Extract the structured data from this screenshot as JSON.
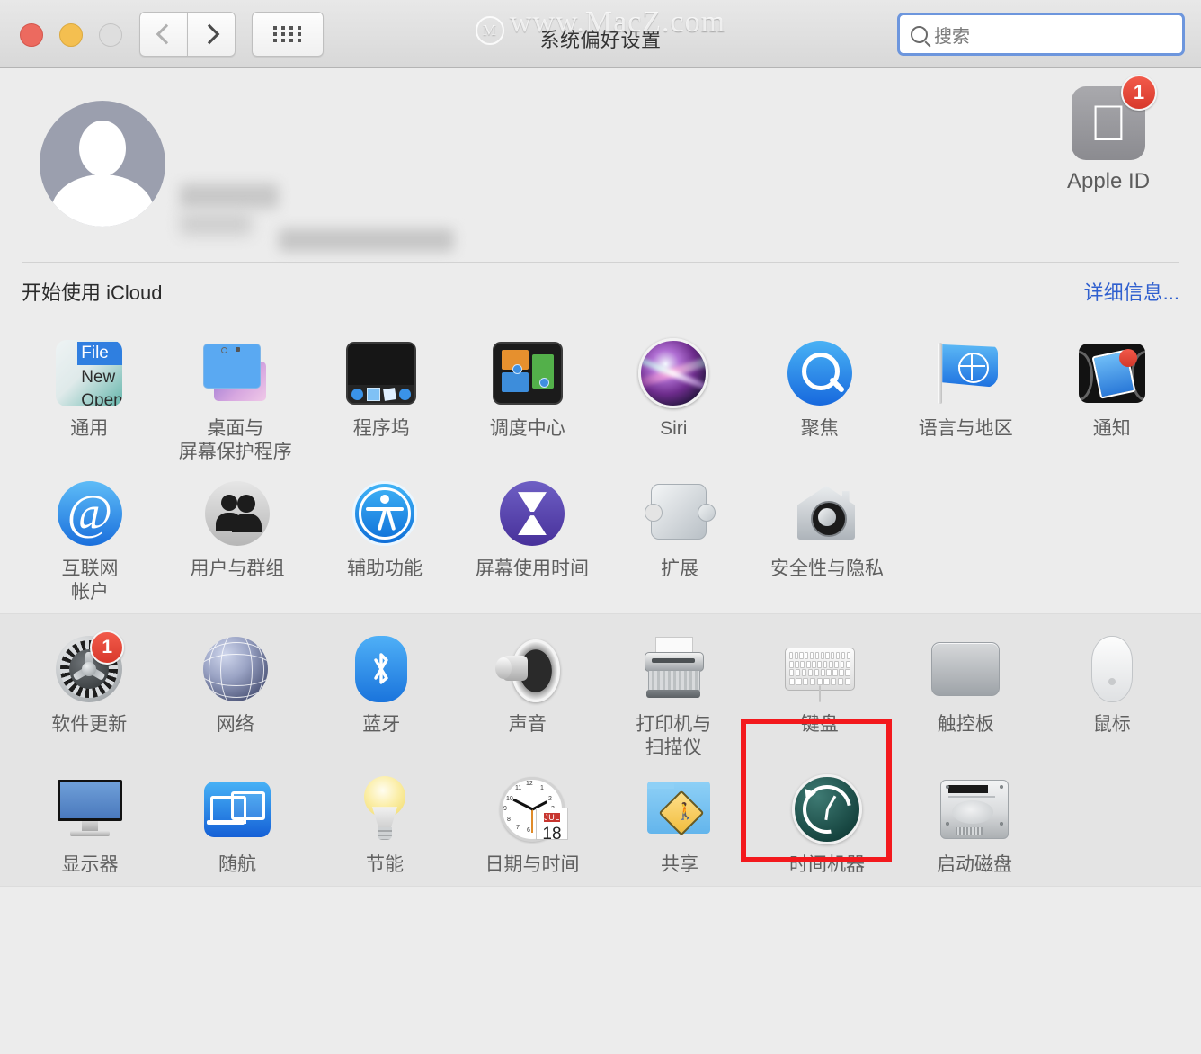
{
  "window": {
    "title": "系统偏好设置",
    "watermark": "www.MacZ.com",
    "watermark_mark": "M"
  },
  "toolbar": {
    "back_icon": "chevron-left-icon",
    "forward_icon": "chevron-right-icon",
    "grid_icon": "grid-view-icon",
    "search_placeholder": "搜索",
    "search_value": ""
  },
  "account": {
    "avatar_icon": "user-avatar-icon",
    "name_redacted": "",
    "email_redacted": "",
    "apple_id": {
      "label": "Apple ID",
      "badge": "1",
      "icon": "apple-logo-icon"
    }
  },
  "icloud": {
    "title": "开始使用 iCloud",
    "link": "详细信息..."
  },
  "sections": [
    {
      "name": "section-one",
      "rows": [
        [
          {
            "label": "通用",
            "icon": "general-icon"
          },
          {
            "label": "桌面与\n屏幕保护程序",
            "icon": "desktop-screensaver-icon"
          },
          {
            "label": "程序坞",
            "icon": "dock-icon"
          },
          {
            "label": "调度中心",
            "icon": "mission-control-icon"
          },
          {
            "label": "Siri",
            "icon": "siri-icon"
          },
          {
            "label": "聚焦",
            "icon": "spotlight-icon"
          },
          {
            "label": "语言与地区",
            "icon": "language-region-icon"
          },
          {
            "label": "通知",
            "icon": "notifications-icon"
          }
        ],
        [
          {
            "label": "互联网\n帐户",
            "icon": "internet-accounts-icon"
          },
          {
            "label": "用户与群组",
            "icon": "users-groups-icon"
          },
          {
            "label": "辅助功能",
            "icon": "accessibility-icon"
          },
          {
            "label": "屏幕使用时间",
            "icon": "screen-time-icon"
          },
          {
            "label": "扩展",
            "icon": "extensions-icon"
          },
          {
            "label": "安全性与隐私",
            "icon": "security-privacy-icon"
          }
        ]
      ]
    },
    {
      "name": "section-two",
      "rows": [
        [
          {
            "label": "软件更新",
            "icon": "software-update-icon",
            "badge": "1"
          },
          {
            "label": "网络",
            "icon": "network-icon"
          },
          {
            "label": "蓝牙",
            "icon": "bluetooth-icon"
          },
          {
            "label": "声音",
            "icon": "sound-icon"
          },
          {
            "label": "打印机与\n扫描仪",
            "icon": "printers-scanners-icon"
          },
          {
            "label": "键盘",
            "icon": "keyboard-icon",
            "highlighted": true
          },
          {
            "label": "触控板",
            "icon": "trackpad-icon"
          },
          {
            "label": "鼠标",
            "icon": "mouse-icon"
          }
        ],
        [
          {
            "label": "显示器",
            "icon": "displays-icon"
          },
          {
            "label": "随航",
            "icon": "sidecar-icon"
          },
          {
            "label": "节能",
            "icon": "energy-saver-icon"
          },
          {
            "label": "日期与时间",
            "icon": "date-time-icon"
          },
          {
            "label": "共享",
            "icon": "sharing-icon"
          },
          {
            "label": "时间机器",
            "icon": "time-machine-icon"
          },
          {
            "label": "启动磁盘",
            "icon": "startup-disk-icon"
          }
        ]
      ]
    }
  ],
  "date_time_icon": {
    "month": "JUL",
    "day": "18"
  },
  "general_icon_menu": {
    "file": "File",
    "new": "New",
    "open": "Open"
  },
  "highlight": {
    "color": "#f3191d",
    "target": "键盘"
  },
  "colors": {
    "window_bg": "#ececec",
    "section_alt_bg": "#e4e4e4",
    "link_blue": "#2f5fcf",
    "badge_red": "#d8392c",
    "highlight_red": "#f3191d",
    "label_gray": "#5f5f5f"
  }
}
